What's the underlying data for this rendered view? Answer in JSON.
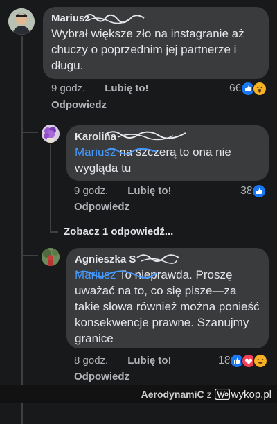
{
  "comments": [
    {
      "author": "Mariusz",
      "text": "Wybrał większe zło na instagranie aż chuczy o poprzednim jej partnerze i długu.",
      "time": "9 godz.",
      "like_label": "Lubię to!",
      "reply_label": "Odpowiedz",
      "reactions": {
        "count": "66",
        "icons": [
          "like-icon",
          "wow-icon"
        ]
      }
    },
    {
      "author": "Karolina",
      "mention": "Mariusz",
      "text": " na szczerą to ona nie wygląda tu",
      "time": "9 godz.",
      "like_label": "Lubię to!",
      "reply_label": "Odpowiedz",
      "reactions": {
        "count": "38",
        "icons": [
          "like-icon"
        ]
      }
    },
    {
      "author": "Agnieszka S",
      "mention": "Mariusz",
      "text": "To nieprawda. Proszę uważać na to, co się pisze—za takie słowa również można ponieść konsekwencje prawne. Szanujmy granice",
      "time": "8 godz.",
      "like_label": "Lubię to!",
      "reply_label": "Odpowiedz",
      "reactions": {
        "count": "18",
        "icons": [
          "like-icon",
          "love-icon",
          "haha-icon"
        ]
      }
    }
  ],
  "view_more": "Zobacz 1 odpowiedź...",
  "footer": {
    "username": "AerodynamiC",
    "suffix": "z",
    "brand": "wykop.pl"
  },
  "colors": {
    "background": "#18191a",
    "bubble": "#3a3b3c",
    "mention": "#4599ff",
    "like": "#1877f2",
    "love": "#f33e58",
    "haha": "#f7b125"
  }
}
